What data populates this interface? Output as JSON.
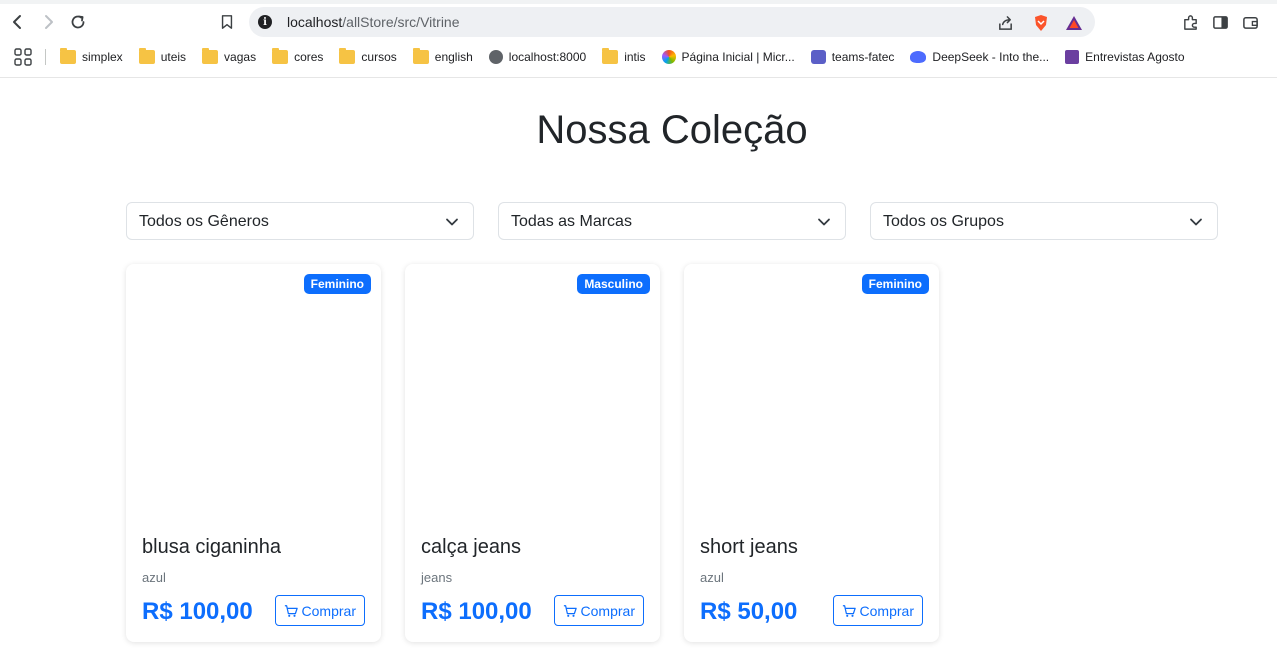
{
  "browser": {
    "url_host": "localhost",
    "url_path": "/allStore/src/Vitrine",
    "bookmarks": [
      {
        "label": "simplex",
        "icon": "folder-icon"
      },
      {
        "label": "uteis",
        "icon": "folder-icon"
      },
      {
        "label": "vagas",
        "icon": "folder-icon"
      },
      {
        "label": "cores",
        "icon": "folder-icon"
      },
      {
        "label": "cursos",
        "icon": "folder-icon"
      },
      {
        "label": "english",
        "icon": "folder-icon"
      },
      {
        "label": "localhost:8000",
        "icon": "globe-icon"
      },
      {
        "label": "intis",
        "icon": "folder-icon"
      },
      {
        "label": "Página Inicial | Micr...",
        "icon": "copilot-icon"
      },
      {
        "label": "teams-fatec",
        "icon": "teams-icon"
      },
      {
        "label": "DeepSeek - Into the...",
        "icon": "deepseek-icon"
      },
      {
        "label": "Entrevistas Agosto",
        "icon": "forms-icon"
      }
    ]
  },
  "page": {
    "title": "Nossa Coleção",
    "filters": {
      "genero": "Todos os Gêneros",
      "marca": "Todas as Marcas",
      "grupo": "Todos os Grupos"
    },
    "products": [
      {
        "badge": "Feminino",
        "name": "blusa ciganinha",
        "desc": "azul",
        "price": "R$ 100,00",
        "buy_label": "Comprar"
      },
      {
        "badge": "Masculino",
        "name": "calça jeans",
        "desc": "jeans",
        "price": "R$ 100,00",
        "buy_label": "Comprar"
      },
      {
        "badge": "Feminino",
        "name": "short jeans",
        "desc": "azul",
        "price": "R$ 50,00",
        "buy_label": "Comprar"
      }
    ]
  },
  "colors": {
    "accent": "#0d6efd",
    "text": "#212529",
    "muted": "#6c757d"
  }
}
